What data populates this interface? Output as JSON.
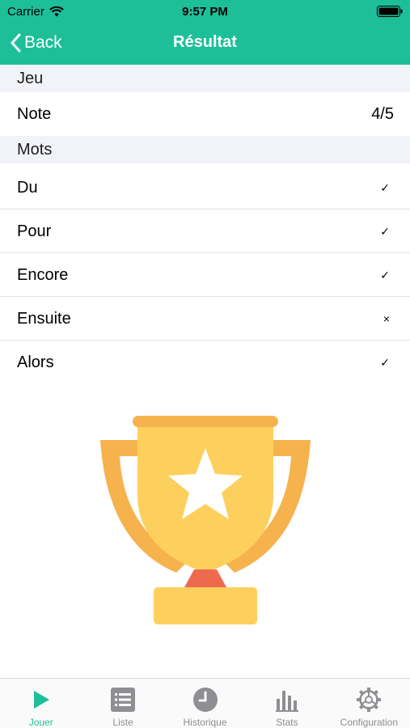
{
  "status": {
    "carrier": "Carrier",
    "time": "9:57 PM"
  },
  "nav": {
    "back_label": "Back",
    "title": "Résultat"
  },
  "sections": {
    "game": "Jeu",
    "words": "Mots"
  },
  "score": {
    "label": "Note",
    "value": "4/5"
  },
  "words": [
    {
      "word": "Du",
      "mark": "✓",
      "correct": true
    },
    {
      "word": "Pour",
      "mark": "✓",
      "correct": true
    },
    {
      "word": "Encore",
      "mark": "✓",
      "correct": true
    },
    {
      "word": "Ensuite",
      "mark": "×",
      "correct": false
    },
    {
      "word": "Alors",
      "mark": "✓",
      "correct": true
    }
  ],
  "tabs": [
    {
      "label": "Jouer",
      "icon": "play-icon",
      "active": true
    },
    {
      "label": "Liste",
      "icon": "list-icon",
      "active": false
    },
    {
      "label": "Historique",
      "icon": "clock-icon",
      "active": false
    },
    {
      "label": "Stats",
      "icon": "bar-chart-icon",
      "active": false
    },
    {
      "label": "Configuration",
      "icon": "gear-icon",
      "active": false
    }
  ],
  "colors": {
    "accent": "#1dbf99",
    "section_bg": "#f2f3f8",
    "tab_inactive": "#8e8e93"
  }
}
